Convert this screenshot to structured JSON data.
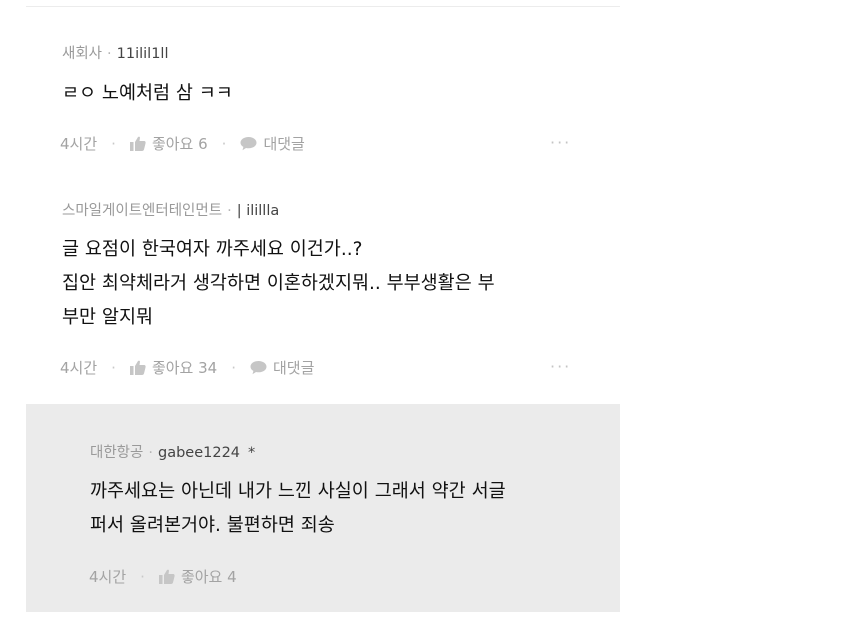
{
  "comments": [
    {
      "company": "새회사",
      "username": "11ilil1ll",
      "lines": [
        "ㄹㅇ 노예처럼 삼 ㅋㅋ"
      ],
      "time": "4시간",
      "likes_label": "좋아요 6",
      "reply_label": "대댓글",
      "more_label": "···"
    },
    {
      "company": "스마일게이트엔터테인먼트",
      "username": "| ilillla",
      "lines": [
        "글 요점이 한국여자 까주세요  이건가..?",
        "집안 최약체라거 생각하면 이혼하겠지뭐.. 부부생활은 부",
        "부만 알지뭐"
      ],
      "time": "4시간",
      "likes_label": "좋아요 34",
      "reply_label": "대댓글",
      "more_label": "···"
    }
  ],
  "reply": {
    "company": "대한항공",
    "username": "gabee1224",
    "author_mark": "*",
    "lines": [
      "까주세요는 아닌데 내가 느낀 사실이 그래서 약간 서글",
      "퍼서 올려본거야. 불편하면 죄송"
    ],
    "time": "4시간",
    "likes_label": "좋아요 4"
  },
  "icons": [
    "thumbs-up-icon",
    "speech-bubble-icon",
    "more-dots-icon"
  ],
  "colors": {
    "reply_background": "#ebebeb",
    "meta_text": "#999999",
    "body_text": "#111111"
  }
}
